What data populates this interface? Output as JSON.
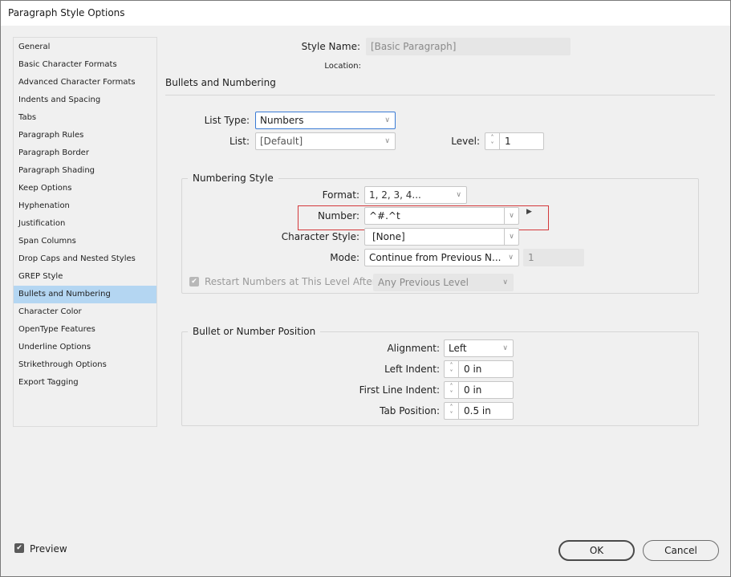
{
  "window": {
    "title": "Paragraph Style Options"
  },
  "sidebar": {
    "selected_index": 15,
    "items": [
      {
        "label": "General"
      },
      {
        "label": "Basic Character Formats"
      },
      {
        "label": "Advanced Character Formats"
      },
      {
        "label": "Indents and Spacing"
      },
      {
        "label": "Tabs"
      },
      {
        "label": "Paragraph Rules"
      },
      {
        "label": "Paragraph Border"
      },
      {
        "label": "Paragraph Shading"
      },
      {
        "label": "Keep Options"
      },
      {
        "label": "Hyphenation"
      },
      {
        "label": "Justification"
      },
      {
        "label": "Span Columns"
      },
      {
        "label": "Drop Caps and Nested Styles"
      },
      {
        "label": "GREP Style"
      },
      {
        "label": "Bullets and Numbering"
      },
      {
        "label": "Character Color"
      },
      {
        "label": "OpenType Features"
      },
      {
        "label": "Underline Options"
      },
      {
        "label": "Strikethrough Options"
      },
      {
        "label": "Export Tagging"
      }
    ]
  },
  "header": {
    "style_name_label": "Style Name:",
    "style_name_value": "[Basic Paragraph]",
    "location_label": "Location:",
    "section_title": "Bullets and Numbering"
  },
  "list": {
    "list_type_label": "List Type:",
    "list_type_value": "Numbers",
    "list_label": "List:",
    "list_value": "[Default]",
    "level_label": "Level:",
    "level_value": "1"
  },
  "numbering_style": {
    "title": "Numbering Style",
    "format_label": "Format:",
    "format_value": "1, 2, 3, 4...",
    "number_label": "Number:",
    "number_value": "^#.^t",
    "char_style_label": "Character Style:",
    "char_style_value": "[None]",
    "mode_label": "Mode:",
    "mode_value": "Continue from Previous N...",
    "mode_start_value": "1",
    "restart_label": "Restart Numbers at This Level After:",
    "restart_checked": true,
    "restart_value": "Any Previous Level"
  },
  "position": {
    "title": "Bullet or Number Position",
    "alignment_label": "Alignment:",
    "alignment_value": "Left",
    "left_indent_label": "Left Indent:",
    "left_indent_value": "0 in",
    "first_line_label": "First Line Indent:",
    "first_line_value": "0 in",
    "tab_position_label": "Tab Position:",
    "tab_position_value": "0.5 in"
  },
  "footer": {
    "preview_label": "Preview",
    "preview_checked": true,
    "ok_label": "OK",
    "cancel_label": "Cancel"
  },
  "icons": {
    "chevron": "⌵",
    "spin_up": "˄",
    "spin_down": "˅",
    "flyout": "▶",
    "check": "✔"
  }
}
